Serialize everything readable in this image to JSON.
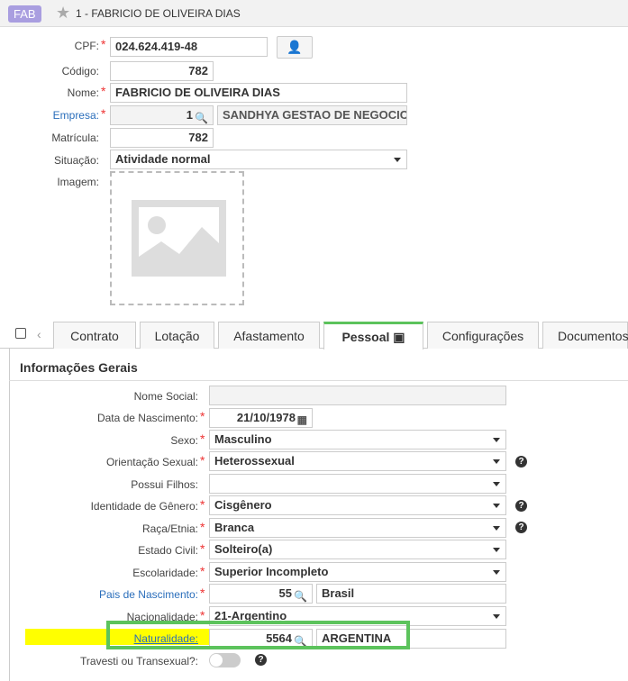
{
  "window": {
    "badge": "FAB",
    "title": "1 - FABRICIO DE OLIVEIRA DIAS"
  },
  "top_form": {
    "cpf": {
      "label": "CPF:",
      "value": "024.624.419-48"
    },
    "codigo": {
      "label": "Código:",
      "value": "782"
    },
    "nome": {
      "label": "Nome:",
      "value": "FABRICIO DE OLIVEIRA DIAS"
    },
    "empresa": {
      "label": "Empresa:",
      "code": "1",
      "name": "SANDHYA GESTAO DE NEGOCIC"
    },
    "matricula": {
      "label": "Matrícula:",
      "value": "782"
    },
    "situacao": {
      "label": "Situação:",
      "value": "Atividade normal"
    },
    "imagem": {
      "label": "Imagem:"
    }
  },
  "tabs": [
    "Contrato",
    "Lotação",
    "Afastamento",
    "Pessoal",
    "Configurações",
    "Documentos"
  ],
  "active_tab": "Pessoal",
  "section_title": "Informações Gerais",
  "fields": {
    "nome_social": {
      "label": "Nome Social:",
      "value": ""
    },
    "data_nascimento": {
      "label": "Data de Nascimento:",
      "value": "21/10/1978"
    },
    "sexo": {
      "label": "Sexo:",
      "value": "Masculino"
    },
    "orientacao": {
      "label": "Orientação Sexual:",
      "value": "Heterossexual"
    },
    "possui_filhos": {
      "label": "Possui Filhos:",
      "value": ""
    },
    "identidade": {
      "label": "Identidade de Gênero:",
      "value": "Cisgênero"
    },
    "raca": {
      "label": "Raça/Etnia:",
      "value": "Branca"
    },
    "estado_civil": {
      "label": "Estado Civil:",
      "value": "Solteiro(a)"
    },
    "escolaridade": {
      "label": "Escolaridade:",
      "value": "Superior Incompleto"
    },
    "pais": {
      "label": "Pais de Nascimento:",
      "code": "55",
      "name": "Brasil"
    },
    "nacionalidade": {
      "label": "Nacionalidade:",
      "value": "21-Argentino"
    },
    "naturalidade": {
      "label": "Naturalidade:",
      "code": "5564",
      "name": "ARGENTINA"
    },
    "travesti": {
      "label": "Travesti ou Transexual?:",
      "value": false
    }
  },
  "colors": {
    "accent_green": "#5cc35c",
    "highlight_yellow": "#ffff00",
    "link_blue": "#2a6ebb",
    "badge_purple": "#a99ee0"
  }
}
